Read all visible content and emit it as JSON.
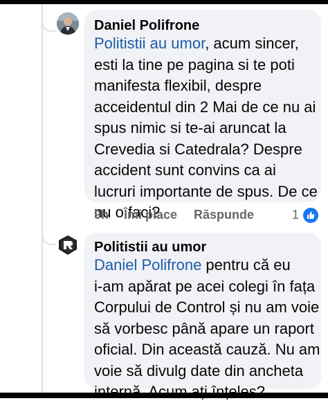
{
  "thread": {
    "comment": {
      "author": "Daniel Polifrone",
      "mention": "Politistii au umor",
      "lines": [
        ", acum sincer,",
        "esti la tine pe pagina si te poti",
        "manifesta flexibil, despre",
        "acceidentul din 2 Mai de ce nu ai",
        "spus nimic si te-ai aruncat la",
        "Crevedia si Catedrala? Despre",
        "accident sunt convins ca ai",
        "lucruri importante de spus. De ce",
        "nu o faci?"
      ],
      "time": "9h",
      "like_label": "Îmi place",
      "reply_label": "Răspunde",
      "reaction_count": "1",
      "reaction_icon": "thumbs-up-icon",
      "reaction_color": "#1877f2"
    },
    "reply": {
      "author": "Politistii au umor",
      "mention": "Daniel Polifrone",
      "lines": [
        " pentru că eu",
        "i-am apărat pe acei colegi în fața",
        "Corpului de Control și nu am voie",
        "să vorbesc până apare un raport",
        "oficial. Din această cauză. Nu am",
        "voie să divulg date din ancheta",
        "internă. Acum ați înțeles?"
      ]
    }
  },
  "colors": {
    "mention": "#1d5ba9",
    "bubble": "#f0f2f5",
    "meta_text": "#65676b"
  }
}
